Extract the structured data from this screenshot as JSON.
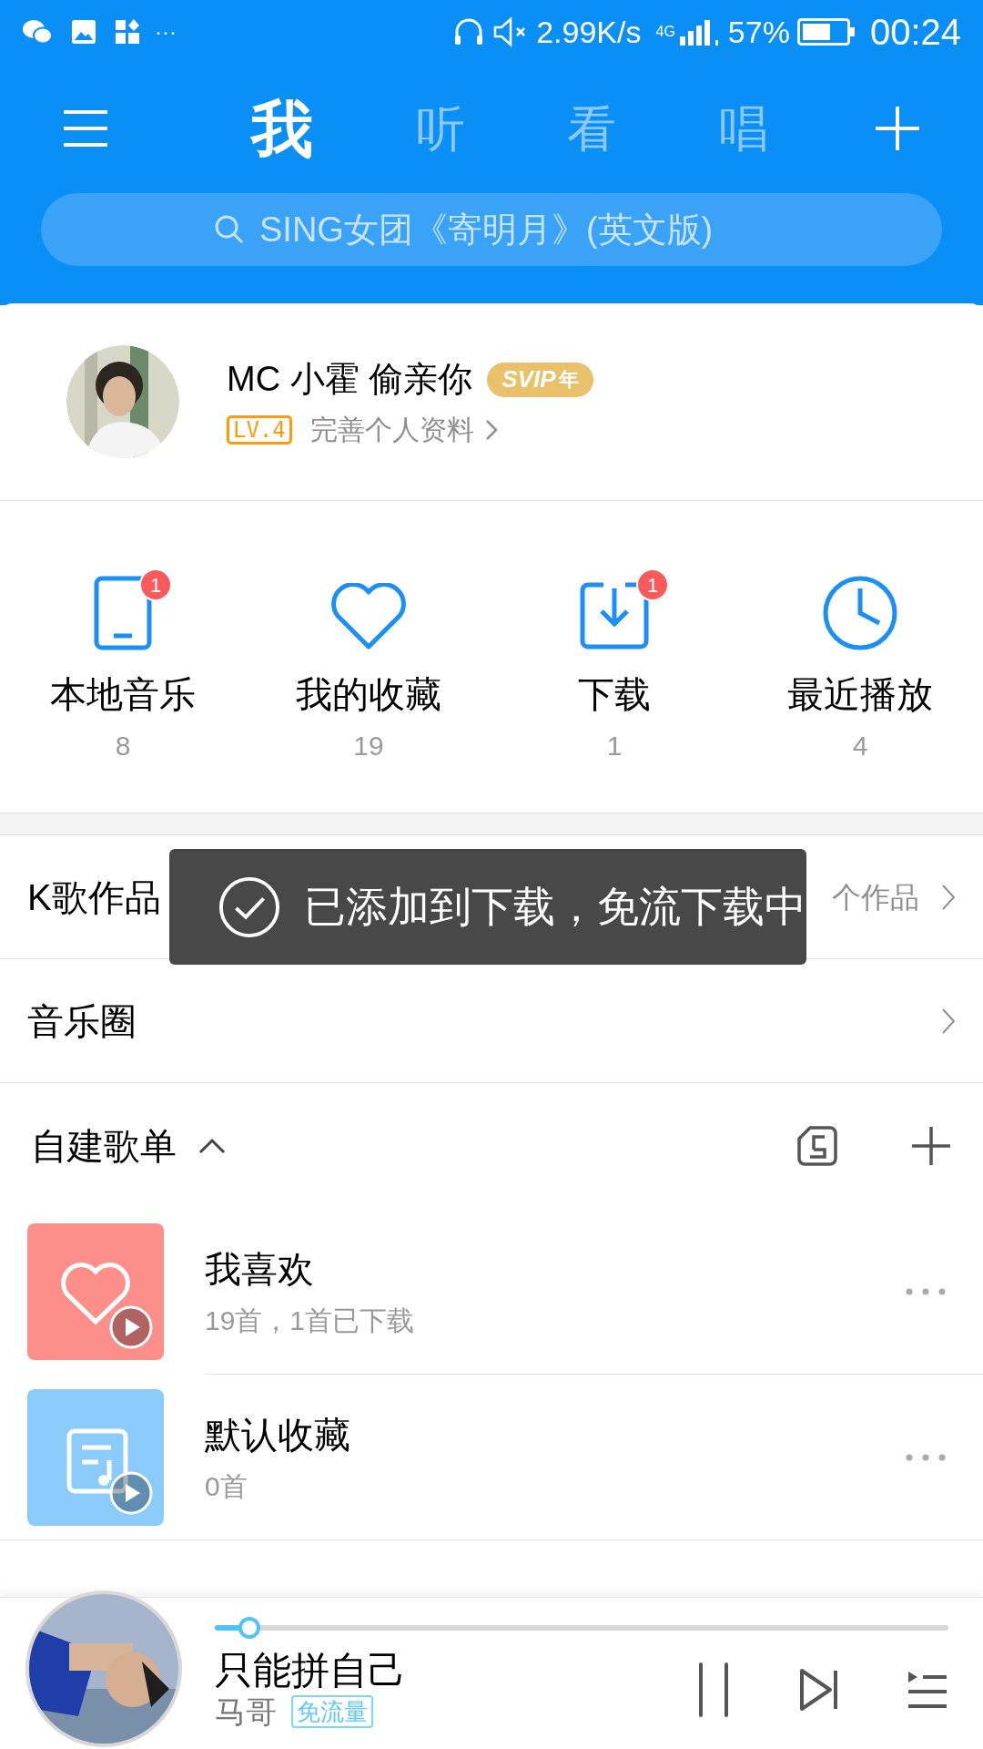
{
  "status_bar": {
    "network_speed": "2.99K/s",
    "network_type": "4G",
    "battery": "57%",
    "time": "00:24",
    "more": "···"
  },
  "tabs": [
    {
      "label": "我",
      "selected": true
    },
    {
      "label": "听",
      "selected": false
    },
    {
      "label": "看",
      "selected": false
    },
    {
      "label": "唱",
      "selected": false
    }
  ],
  "search": {
    "placeholder": "SING女团《寄明月》(英文版)"
  },
  "profile": {
    "name": "MC 小霍 偷亲你",
    "vip_badge": "SVIP",
    "vip_suffix": "年",
    "level": "LV.4",
    "complete_link": "完善个人资料"
  },
  "shortcuts": [
    {
      "kind": "phone",
      "label": "本地音乐",
      "count": "8",
      "badge": "1"
    },
    {
      "kind": "heart",
      "label": "我的收藏",
      "count": "19"
    },
    {
      "kind": "download",
      "label": "下载",
      "count": "1",
      "badge": "1"
    },
    {
      "kind": "clock",
      "label": "最近播放",
      "count": "4"
    }
  ],
  "rows": [
    {
      "label": "K歌作品",
      "detail": "个作品"
    },
    {
      "label": "音乐圈"
    }
  ],
  "toast": {
    "text": "已添加到下载，免流下载中"
  },
  "playlists_header": {
    "title": "自建歌单",
    "expanded": true
  },
  "playlists": [
    {
      "kind": "heart",
      "color": "#fd8e8a",
      "title": "我喜欢",
      "subtitle": "19首，1首已下载"
    },
    {
      "kind": "note",
      "color": "#8acbfc",
      "title": "默认收藏",
      "subtitle": "0首"
    }
  ],
  "player": {
    "level": 0.04,
    "song": "只能拼自己",
    "artist": "马哥",
    "tag": "免流量"
  }
}
